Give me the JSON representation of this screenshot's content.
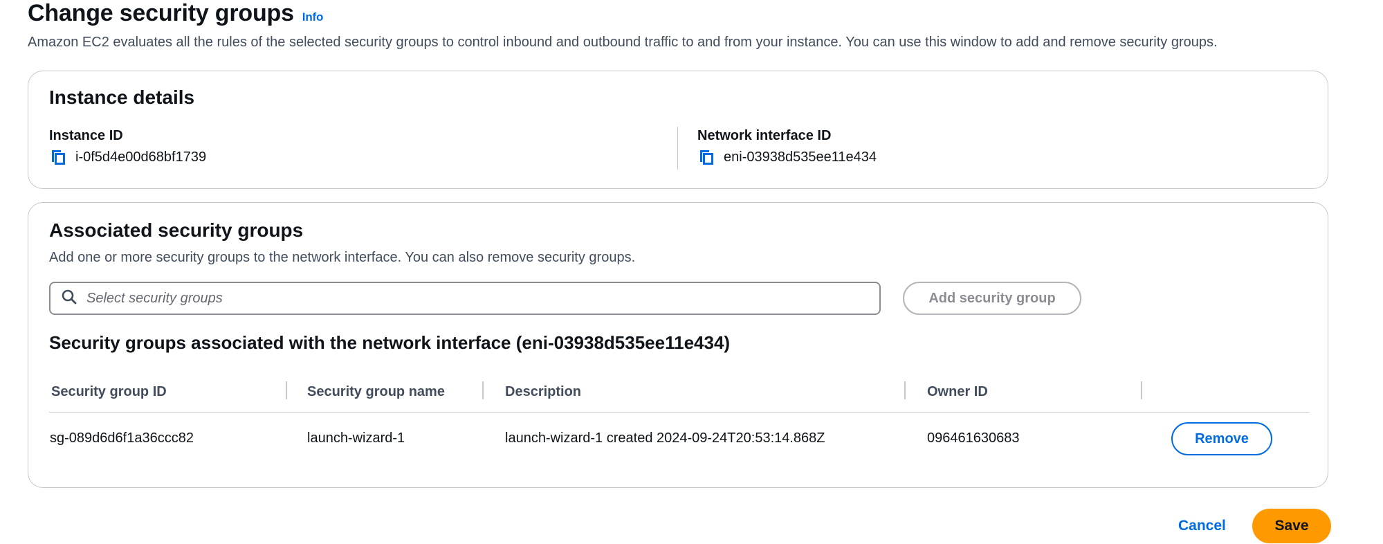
{
  "page": {
    "title": "Change security groups",
    "info_label": "Info",
    "description": "Amazon EC2 evaluates all the rules of the selected security groups to control inbound and outbound traffic to and from your instance. You can use this window to add and remove security groups."
  },
  "instance_details": {
    "header": "Instance details",
    "instance_id_label": "Instance ID",
    "instance_id_value": "i-0f5d4e00d68bf1739",
    "network_interface_label": "Network interface ID",
    "network_interface_value": "eni-03938d535ee11e434"
  },
  "associated_groups": {
    "header": "Associated security groups",
    "description": "Add one or more security groups to the network interface. You can also remove security groups.",
    "search_placeholder": "Select security groups",
    "add_button_label": "Add security group",
    "table_title": "Security groups associated with the network interface (eni-03938d535ee11e434)",
    "columns": [
      "Security group ID",
      "Security group name",
      "Description",
      "Owner ID"
    ],
    "rows": [
      {
        "id": "sg-089d6d6f1a36ccc82",
        "name": "launch-wizard-1",
        "description": "launch-wizard-1 created 2024-09-24T20:53:14.868Z",
        "owner": "096461630683",
        "action": "Remove"
      }
    ]
  },
  "footer": {
    "cancel_label": "Cancel",
    "save_label": "Save"
  },
  "colors": {
    "link_blue": "#006ce0",
    "primary_orange": "#ff9900",
    "border_gray": "#c6c6cd"
  },
  "icons": {
    "copy": "copy-icon",
    "search": "search-icon"
  }
}
